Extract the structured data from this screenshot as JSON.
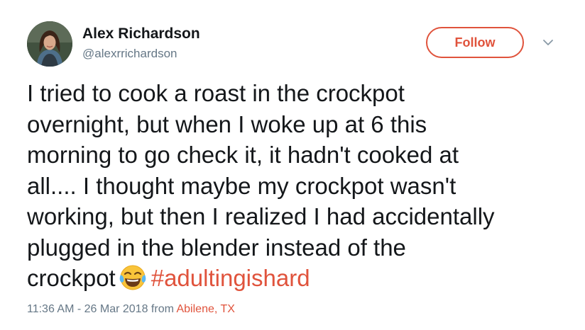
{
  "author": {
    "name": "Alex Richardson",
    "handle": "@alexrrichardson",
    "avatar_icon": "profile-photo"
  },
  "header": {
    "follow_label": "Follow",
    "menu_icon": "chevron-down-icon"
  },
  "tweet": {
    "lines": [
      "I tried to cook a roast in the crockpot",
      "overnight, but when I woke up at 6 this",
      "morning to go check it, it hadn't cooked at",
      "all.... I thought maybe my crockpot wasn't",
      "working, but then I realized I had accidentally",
      "plugged in the blender instead of the"
    ],
    "last_line_text": "crockpot",
    "emoji": "face-with-tears-of-joy",
    "hashtag": "#adultingishard"
  },
  "meta": {
    "timestamp": "11:36 AM - 26 Mar 2018",
    "from_label": "from",
    "location": "Abilene, TX"
  },
  "colors": {
    "accent": "#e0533c",
    "text": "#14171a",
    "muted": "#657786"
  }
}
